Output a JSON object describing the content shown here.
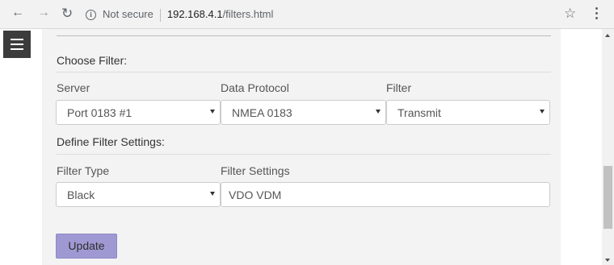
{
  "browser": {
    "address": {
      "security_label": "Not secure",
      "host": "192.168.4.1",
      "path": "/filters.html"
    },
    "icons": {
      "back": "arrow-left-icon",
      "forward": "arrow-right-icon",
      "reload": "reload-icon",
      "info": "info-icon",
      "bookmark": "star-icon",
      "menu": "kebab-menu-icon"
    }
  },
  "page": {
    "choose_filter": {
      "heading": "Choose Filter:",
      "server": {
        "label": "Server",
        "value": "Port 0183 #1"
      },
      "protocol": {
        "label": "Data Protocol",
        "value": "NMEA 0183"
      },
      "filter": {
        "label": "Filter",
        "value": "Transmit"
      }
    },
    "define_filter": {
      "heading": "Define Filter Settings:",
      "filter_type": {
        "label": "Filter Type",
        "value": "Black"
      },
      "filter_settings": {
        "label": "Filter Settings",
        "value": "VDO VDM"
      }
    },
    "update_label": "Update"
  },
  "colors": {
    "panel_bg": "#f3f3f3",
    "menu_button_bg": "#3c3c3c",
    "update_button_bg": "#9e99d3"
  }
}
